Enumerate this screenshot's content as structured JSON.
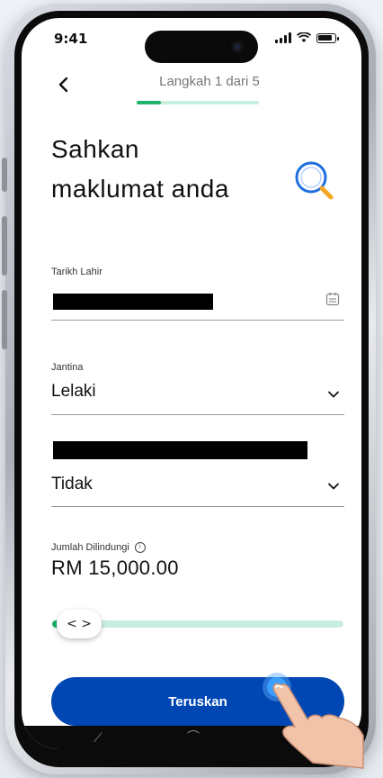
{
  "status_bar": {
    "time": "9:41"
  },
  "header": {
    "back_icon": "chevron-left-icon",
    "step_label": "Langkah 1 dari 5",
    "step_progress": 0.2
  },
  "title": "Sahkan maklumat anda",
  "form": {
    "dob": {
      "label": "Tarikh Lahir",
      "value_redacted": true,
      "icon": "calendar-icon"
    },
    "gender": {
      "label": "Jantina",
      "value": "Lelaki",
      "icon": "chevron-down-icon"
    },
    "smoker": {
      "label_redacted": true,
      "value": "Tidak",
      "icon": "chevron-down-icon"
    },
    "sum_assured": {
      "label": "Jumlah Dilindungi",
      "info_icon": "info-icon",
      "info_glyph": "i",
      "value": "RM 15,000.00",
      "slider_level": 0.04,
      "slider_arrows": "< >"
    }
  },
  "continue_button": {
    "label": "Teruskan"
  },
  "colors": {
    "primary_blue": "#0047b3",
    "progress_green": "#1fb36b",
    "track_green": "#c8eedd"
  }
}
